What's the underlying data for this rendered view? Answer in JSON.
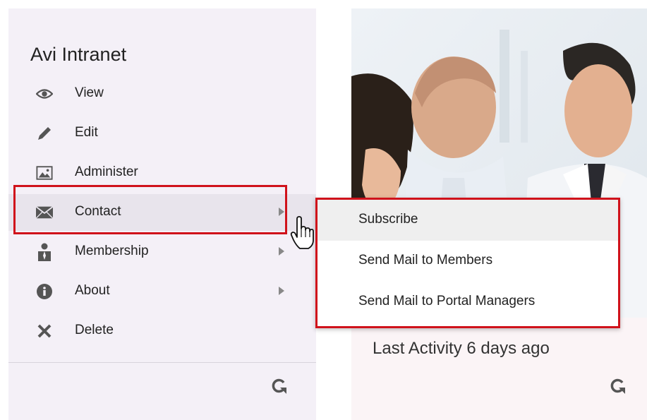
{
  "sidebar": {
    "title": "Avi Intranet",
    "items": [
      {
        "label": "View",
        "icon": "eye-icon",
        "has_submenu": false
      },
      {
        "label": "Edit",
        "icon": "pencil-icon",
        "has_submenu": false
      },
      {
        "label": "Administer",
        "icon": "image-icon",
        "has_submenu": false
      },
      {
        "label": "Contact",
        "icon": "envelope-icon",
        "has_submenu": true
      },
      {
        "label": "Membership",
        "icon": "user-icon",
        "has_submenu": true
      },
      {
        "label": "About",
        "icon": "info-icon",
        "has_submenu": true
      },
      {
        "label": "Delete",
        "icon": "x-icon",
        "has_submenu": false
      }
    ]
  },
  "contact_submenu": {
    "items": [
      {
        "label": "Subscribe"
      },
      {
        "label": "Send Mail to Members"
      },
      {
        "label": "Send Mail to Portal Managers"
      }
    ]
  },
  "card": {
    "activity": "Last Activity 6 days ago"
  },
  "colors": {
    "highlight": "#d0121b",
    "panel_bg": "#f4f0f7",
    "icon": "#555555"
  }
}
